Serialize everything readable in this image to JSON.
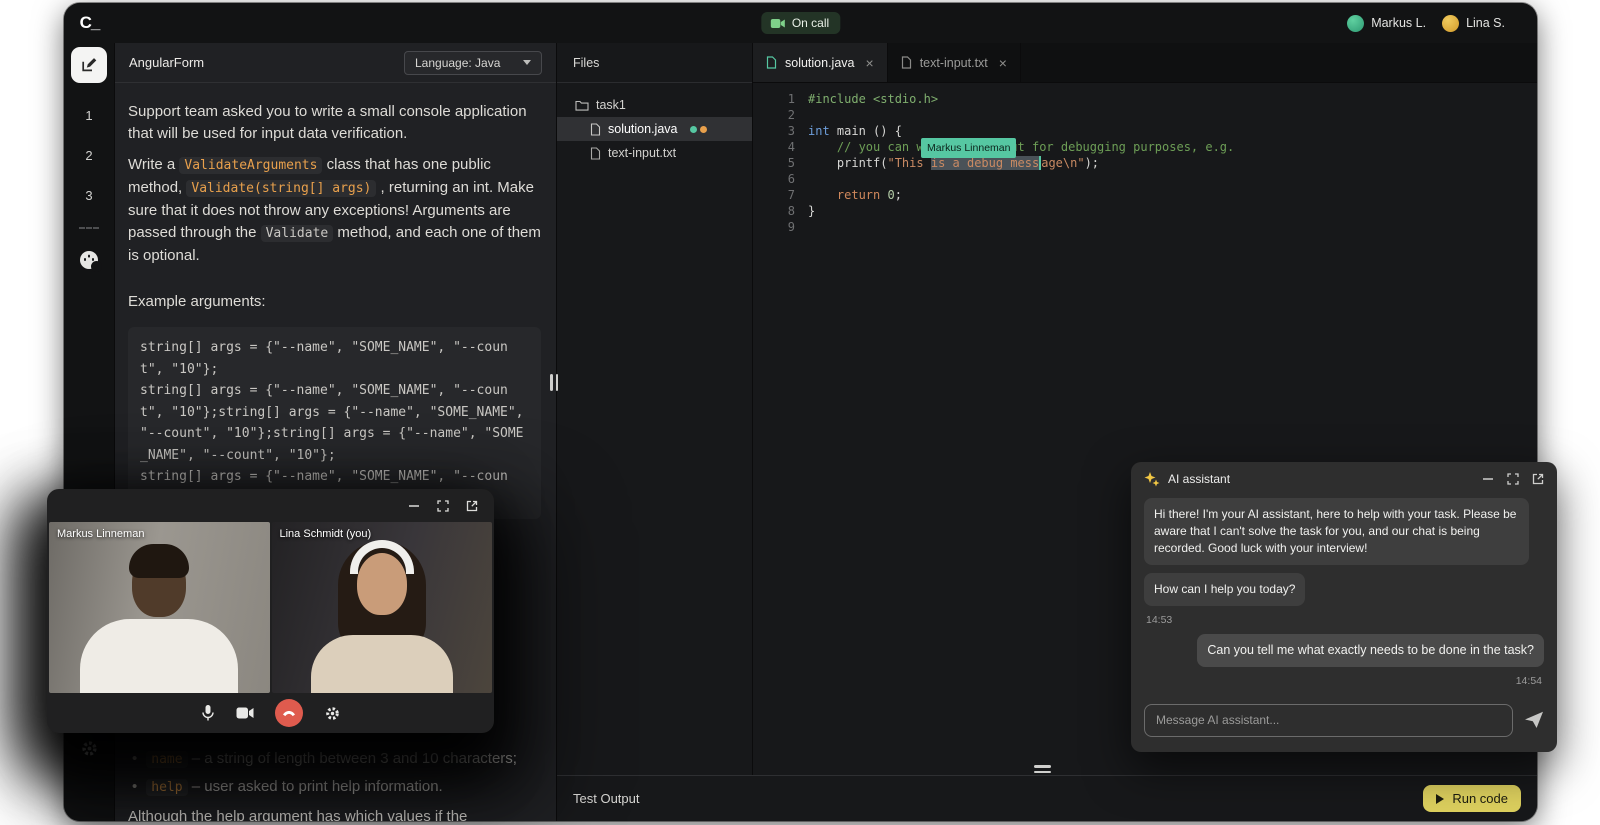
{
  "topbar": {
    "logo": "C_",
    "on_call": "On call",
    "user1": "Markus L.",
    "user2": "Lina S."
  },
  "rail": {
    "step1": "1",
    "step2": "2",
    "step3": "3"
  },
  "task": {
    "title": "AngularForm",
    "language": "Language: Java",
    "p1": "Support team asked you to write a small console application that will be used for input data verification.",
    "p2a": "Write a ",
    "p2_code1": "ValidateArguments",
    "p2b": " class that has one public method, ",
    "p2_code2": "Validate(string[] args)",
    "p2c": " , returning an int. Make sure that it does not throw any exceptions! Arguments are passed through the ",
    "p2_code3": "Validate",
    "p2d": " method, and each one of them is optional.",
    "example_label": "Example arguments:",
    "example_code": "string[] args = {\"--name\", \"SOME_NAME\", \"--count\", \"10\"};\nstring[] args = {\"--name\", \"SOME_NAME\", \"--count\", \"10\"};string[] args = {\"--name\", \"SOME_NAME\", \"--count\", \"10\"};string[] args = {\"--name\", \"SOME_NAME\", \"--count\", \"10\"};\nstring[] args = {\"--name\", \"SOME_NAME\", \"--count\", \"10\"};",
    "bullet1_code": "name",
    "bullet1_text": " – a string of length between 3 and 10 characters;",
    "bullet2_code": "help",
    "bullet2_text": " – user asked to print help information.",
    "clipped": "Although the help argument has which values if the"
  },
  "files": {
    "header": "Files",
    "folder": "task1",
    "file1": "solution.java",
    "file2": "text-input.txt"
  },
  "editor": {
    "tab1": "solution.java",
    "tab2": "text-input.txt",
    "cursor_label": "Markus Linneman",
    "gutter": [
      "1",
      "2",
      "3",
      "4",
      "5",
      "6",
      "7",
      "8",
      "9"
    ],
    "lines": [
      [
        {
          "t": "#include <stdio.h>",
          "c": "pp"
        }
      ],
      [],
      [
        {
          "t": "int",
          "c": "kw"
        },
        {
          "t": " main () {",
          "c": "fg"
        }
      ],
      [
        {
          "t": "    ",
          "c": "fg"
        },
        {
          "t": "// you can write to stdout for debugging purposes, e.g.",
          "c": "cm"
        }
      ],
      [
        {
          "t": "    printf(",
          "c": "fg"
        },
        {
          "t": "\"This ",
          "c": "str"
        },
        {
          "t": "is a debug mess",
          "c": "str sel"
        },
        {
          "t": "age\\n\"",
          "c": "str"
        },
        {
          "t": ");",
          "c": "fg"
        }
      ],
      [],
      [
        {
          "t": "    ",
          "c": "fg"
        },
        {
          "t": "return",
          "c": "kw2"
        },
        {
          "t": " ",
          "c": "fg"
        },
        {
          "t": "0",
          "c": "num"
        },
        {
          "t": ";",
          "c": "fg"
        }
      ],
      [
        {
          "t": "}",
          "c": "fg"
        }
      ],
      []
    ]
  },
  "assistant": {
    "title": "AI assistant",
    "msg1": "Hi there! I'm your AI assistant, here to help with your task. Please be aware that I can't solve the task for you, and our chat is being recorded. Good luck with your interview!",
    "msg2": "How can I help you today?",
    "time1": "14:53",
    "msg3": "Can you tell me what exactly needs to be done in the task?",
    "time2": "14:54",
    "placeholder": "Message AI assistant..."
  },
  "call": {
    "name1": "Markus Linneman",
    "name2": "Lina Schmidt (you)"
  },
  "bottom": {
    "test_output": "Test Output",
    "run_code": "Run code"
  },
  "colors": {
    "collaborator_markus_teal": "#56c7a2",
    "collaborator_lina_orange": "#e8a04c",
    "run_button_yellow": "#ddd05e",
    "on_call_green": "#7fd18a"
  }
}
